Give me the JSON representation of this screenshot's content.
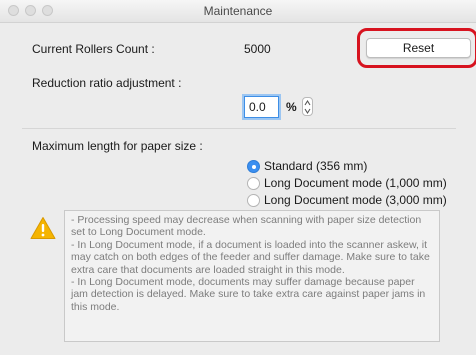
{
  "window": {
    "title": "Maintenance"
  },
  "rollers": {
    "label": "Current Rollers Count :",
    "value": "5000",
    "reset_label": "Reset"
  },
  "reduction": {
    "label": "Reduction ratio adjustment :",
    "value": "0.0",
    "unit": "%"
  },
  "paper_length": {
    "label": "Maximum length for paper size :",
    "options": [
      {
        "label": "Standard (356 mm)",
        "selected": true
      },
      {
        "label": "Long Document mode (1,000 mm)",
        "selected": false
      },
      {
        "label": "Long Document mode (3,000 mm)",
        "selected": false
      }
    ]
  },
  "warning": {
    "icon": "warning-triangle-icon",
    "lines": [
      "- Processing speed may decrease when scanning with paper size detection set to Long Document mode.",
      "- In Long Document mode, if a document is loaded into the scanner askew, it may catch on both edges of the feeder and suffer damage. Make sure to take extra care that documents are loaded straight in this mode.",
      "- In Long Document mode, documents may suffer damage because paper jam detection is delayed. Make sure to take extra care against paper jams in this mode."
    ]
  },
  "colors": {
    "highlight": "#d7131f",
    "accent": "#3b8ff0",
    "warning": "#f5b400"
  }
}
